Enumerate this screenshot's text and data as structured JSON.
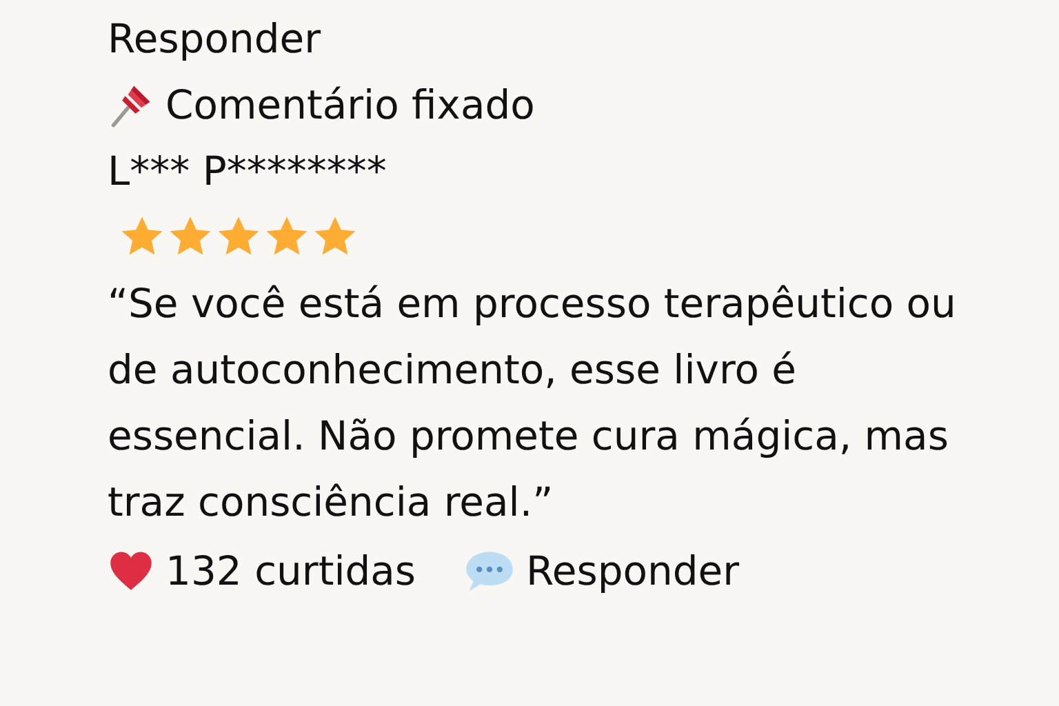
{
  "reply_link": "Responder",
  "pinned": {
    "label": "Comentário fixado"
  },
  "comment": {
    "author": "L*** P********",
    "stars": 5,
    "text": " “Se você está em processo terapêutico ou de autoconhecimento, esse livro é essencial. Não promete cura mágica, mas traz consciência real.”"
  },
  "footer": {
    "likes": "132 curtidas",
    "reply": "Responder"
  }
}
